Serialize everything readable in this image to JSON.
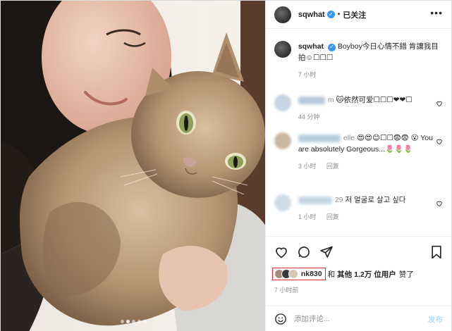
{
  "post": {
    "username": "sqwhat",
    "follow_state": "已关注",
    "more_label": "•••",
    "carousel": {
      "count": 5,
      "active": 2
    }
  },
  "caption": {
    "username": "sqwhat",
    "text": "Boyboy今日心情不錯 肯讓我目拍☺︎☐☐☐",
    "time": "7 小时"
  },
  "comments": [
    {
      "name_visible": "m",
      "text": "🐱依然可爱☐☐☐❤❤☐",
      "time": "44 分钟",
      "reply": ""
    },
    {
      "name_visible": "elle",
      "text": "😍😍😊☐☐😨😨 😮 You are absolutely Gorgeous...🌷🌷🌷",
      "time": "3 小时",
      "reply": "回复"
    },
    {
      "name_visible": "29",
      "text": "저 얼굴로 살고 싶다",
      "time": "1 小时",
      "reply": "回复"
    }
  ],
  "likes": {
    "liker": "nk830",
    "middle": "和",
    "others_label": "其他",
    "count": "1.2万",
    "suffix_bold": "位用户",
    "verb": "赞了"
  },
  "timestamp": "7 小时前",
  "composer": {
    "placeholder": "添加评论...",
    "post_label": "发布"
  },
  "colors": {
    "verified": "#3897f0",
    "highlight_box": "#e02b2b",
    "post_button_disabled": "#b2dffc",
    "muted": "#8e8e8e"
  }
}
